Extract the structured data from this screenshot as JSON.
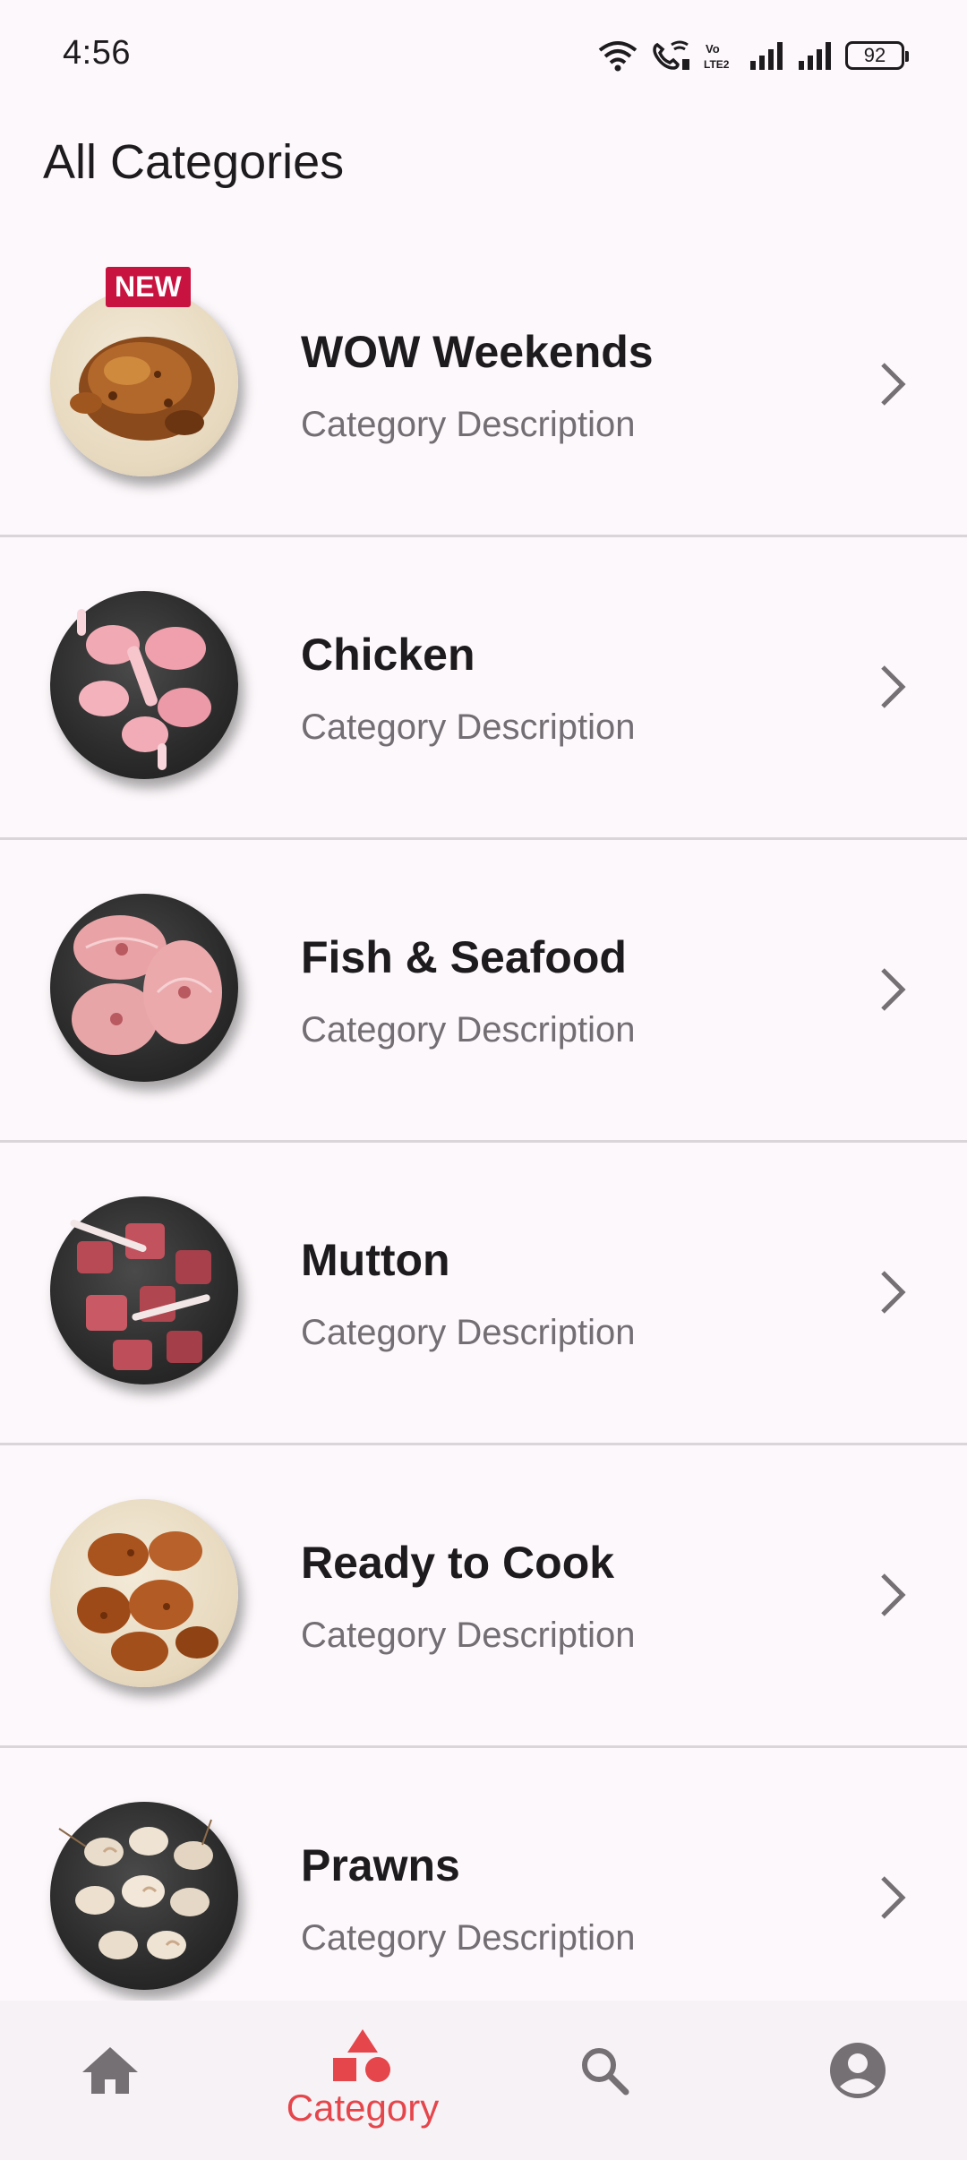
{
  "status_bar": {
    "time": "4:56",
    "battery_level": "92",
    "icons": [
      "wifi-icon",
      "wifi-calling-icon",
      "volte-icon",
      "signal-icon",
      "signal-icon",
      "battery-icon"
    ]
  },
  "page": {
    "title": "All Categories"
  },
  "categories": [
    {
      "title": "WOW Weekends",
      "description": "Category Description",
      "badge": "NEW",
      "image": "roast-chicken-plate"
    },
    {
      "title": "Chicken",
      "description": "Category Description",
      "image": "chicken-legs-plate"
    },
    {
      "title": "Fish & Seafood",
      "description": "Category Description",
      "image": "fish-steaks-plate"
    },
    {
      "title": "Mutton",
      "description": "Category Description",
      "image": "mutton-cuts-plate"
    },
    {
      "title": "Ready to Cook",
      "description": "Category Description",
      "image": "marinated-chicken-plate"
    },
    {
      "title": "Prawns",
      "description": "Category Description",
      "image": "prawns-plate"
    }
  ],
  "bottom_nav": {
    "items": [
      {
        "icon": "home-icon",
        "label": "",
        "active": false
      },
      {
        "icon": "category-icon",
        "label": "Category",
        "active": true
      },
      {
        "icon": "search-icon",
        "label": "",
        "active": false
      },
      {
        "icon": "account-icon",
        "label": "",
        "active": false
      }
    ]
  },
  "colors": {
    "background": "#FCF8FB",
    "accent": "#E5464B",
    "badge": "#C8123F",
    "divider": "#D9D5D9",
    "secondary_text": "#736E73",
    "inactive_icon": "#747074"
  }
}
